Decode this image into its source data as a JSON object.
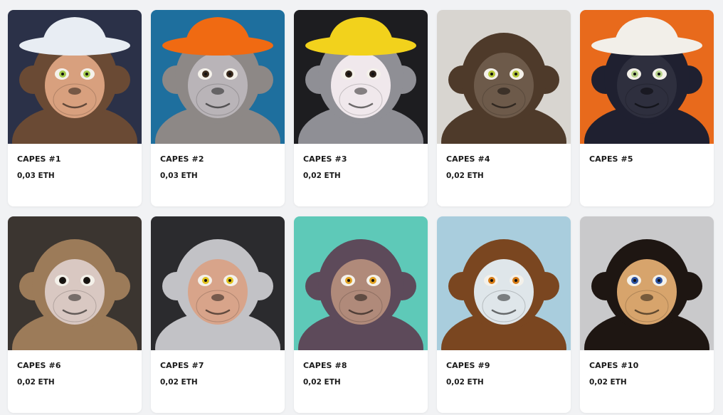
{
  "collection": {
    "items": [
      {
        "name": "CAPES #1",
        "price": "0,03 ETH",
        "bg": "#2b3148",
        "fur": "#6a4a34",
        "face": "#d8a07e",
        "hat": "#e8edf3",
        "eye": "#a3c84a"
      },
      {
        "name": "CAPES #2",
        "price": "0,03 ETH",
        "bg": "#1e6f9e",
        "fur": "#8d8886",
        "face": "#b9b4b8",
        "hat": "#f06a12",
        "eye": "#3a2a1c"
      },
      {
        "name": "CAPES #3",
        "price": "0,02 ETH",
        "bg": "#1d1d20",
        "fur": "#8f8f95",
        "face": "#f0e8ec",
        "hat": "#f2d21c",
        "eye": "#2c2218"
      },
      {
        "name": "CAPES #4",
        "price": "0,02 ETH",
        "bg": "#d8d5d0",
        "fur": "#4e3a2a",
        "face": "#6d5a4a",
        "hat": "",
        "eye": "#b6c83a"
      },
      {
        "name": "CAPES #5",
        "price": "",
        "bg": "#e86a1c",
        "fur": "#1f2030",
        "face": "#2e2f3e",
        "hat": "#f2efe9",
        "eye": "#b7d38a"
      },
      {
        "name": "CAPES #6",
        "price": "0,02 ETH",
        "bg": "#3b3530",
        "fur": "#9c7b59",
        "face": "#d9c8c2",
        "hat": "",
        "eye": "#1a1410"
      },
      {
        "name": "CAPES #7",
        "price": "0,02 ETH",
        "bg": "#2b2b2e",
        "fur": "#c2c2c6",
        "face": "#d8a48a",
        "hat": "",
        "eye": "#e0c11c"
      },
      {
        "name": "CAPES #8",
        "price": "0,02 ETH",
        "bg": "#5ec9b8",
        "fur": "#5d4a5a",
        "face": "#b08a7a",
        "hat": "",
        "eye": "#e0a020"
      },
      {
        "name": "CAPES #9",
        "price": "0,02 ETH",
        "bg": "#a9cddd",
        "fur": "#7a4620",
        "face": "#dfe6ea",
        "hat": "",
        "eye": "#d67a14"
      },
      {
        "name": "CAPES #10",
        "price": "0,02 ETH",
        "bg": "#c9c9cb",
        "fur": "#1e1612",
        "face": "#d7a46c",
        "hat": "",
        "eye": "#2a50a0"
      }
    ]
  }
}
